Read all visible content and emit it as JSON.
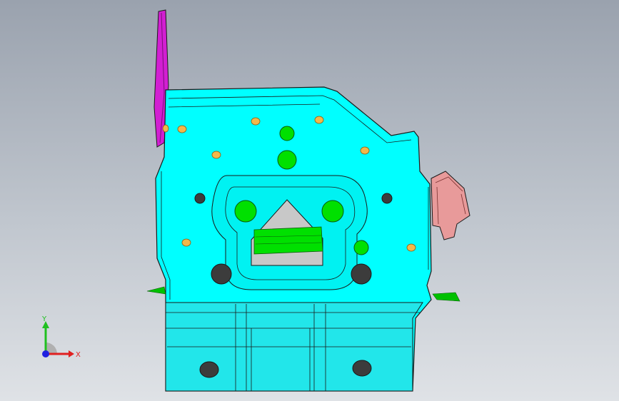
{
  "viewport": {
    "background_top": "#9aa2ae",
    "background_bottom": "#dfe2e6"
  },
  "part": {
    "body_color": "#00ffff",
    "edge_color": "#1a1a1a",
    "hole_fill": "#3c3c3c",
    "feature_color": "#00e000",
    "fastener_color": "#f2b84a"
  },
  "bracket_left": {
    "color": "#d21fd2"
  },
  "bracket_right": {
    "color": "#e89a9a"
  },
  "triad": {
    "x_label": "X",
    "y_label": "Y",
    "x_color": "#e02020",
    "y_color": "#20c020",
    "z_color": "#2020e0"
  }
}
